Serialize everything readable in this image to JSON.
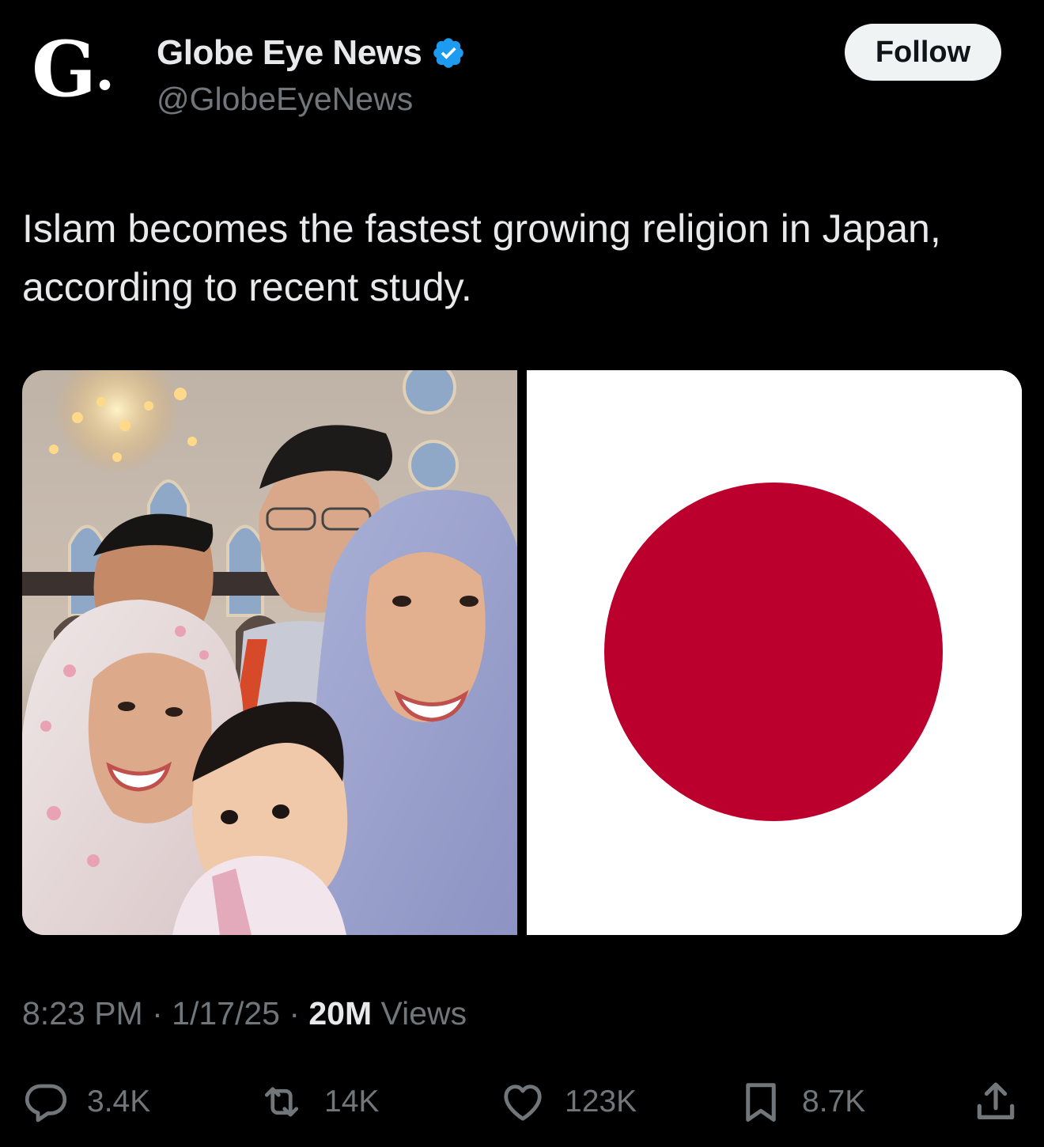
{
  "colors": {
    "background": "#000000",
    "text_primary": "#e7e9ea",
    "text_secondary": "#71767b",
    "verified_blue": "#1d9bf0",
    "follow_bg": "#eff3f4",
    "flag_red": "#bc002d"
  },
  "author": {
    "avatar_text": "G",
    "avatar_dot": ".",
    "display_name": "Globe Eye News",
    "handle": "@GlobeEyeNews",
    "verified_icon": "verified-badge-icon"
  },
  "follow_label": "Follow",
  "tweet": {
    "text": "Islam becomes the fastest growing religion in Japan, according to recent study."
  },
  "media": {
    "left_image": "family-photo-in-mosque",
    "right_image": "japan-flag"
  },
  "meta": {
    "time": "8:23 PM",
    "sep1": " · ",
    "date": "1/17/25",
    "sep2": " · ",
    "views_count": "20M",
    "views_label": " Views"
  },
  "actions": {
    "replies": "3.4K",
    "reposts": "14K",
    "likes": "123K",
    "bookmarks": "8.7K",
    "icons": [
      "reply-icon",
      "repost-icon",
      "like-icon",
      "bookmark-icon",
      "share-icon"
    ]
  }
}
